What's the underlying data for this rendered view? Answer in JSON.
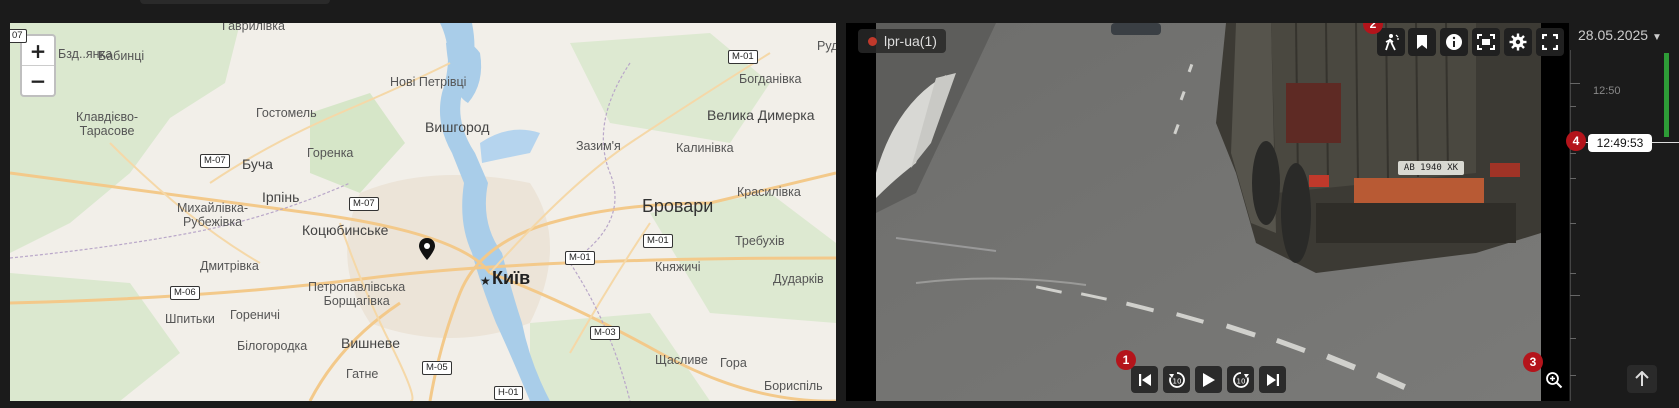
{
  "map": {
    "zoom_in": "+",
    "zoom_out": "−",
    "places": [
      {
        "name": "Бабинці"
      },
      {
        "name": "Нові Петрівці"
      },
      {
        "name": "Гостомель"
      },
      {
        "name": "Вишгород"
      },
      {
        "name": "Клавдієво-\nТарасове"
      },
      {
        "name": "Буча"
      },
      {
        "name": "Горенка"
      },
      {
        "name": "Зазим'я"
      },
      {
        "name": "Богданівка"
      },
      {
        "name": "Велика Димерка"
      },
      {
        "name": "Калинівка"
      },
      {
        "name": "Ірпінь"
      },
      {
        "name": "Михайлівка-\nРубежівка"
      },
      {
        "name": "Коцюбинське"
      },
      {
        "name": "Бровари"
      },
      {
        "name": "Красилівка"
      },
      {
        "name": "Дмитрівка"
      },
      {
        "name": "Требухів"
      },
      {
        "name": "Княжичі"
      },
      {
        "name": "Київ"
      },
      {
        "name": "Дударків"
      },
      {
        "name": "Петропавлівська\nБорщагівка"
      },
      {
        "name": "Шпитьки"
      },
      {
        "name": "Гореничі"
      },
      {
        "name": "Білогородка"
      },
      {
        "name": "Вишневе"
      },
      {
        "name": "Щасливе"
      },
      {
        "name": "Гора"
      },
      {
        "name": "Гатне"
      },
      {
        "name": "Бориспіль"
      },
      {
        "name": "Рудн"
      },
      {
        "name": "Бзд..янка"
      },
      {
        "name": "Гаврилівка"
      }
    ],
    "roads": [
      "М-01",
      "М-07",
      "М-07",
      "М-01",
      "М-01",
      "М-06",
      "М-03",
      "М-05",
      "Н-01",
      "07"
    ]
  },
  "video": {
    "camera_name": "lpr-ua(1)",
    "plate_text": "АВ 1940 ХК",
    "toolbar_icons": [
      "person-motion-icon",
      "bookmark-icon",
      "info-icon",
      "screenshot-icon",
      "settings-icon",
      "fullscreen-icon"
    ],
    "badges": {
      "playback": "1",
      "toolbar": "2",
      "zoom": "3",
      "timeline": "4"
    }
  },
  "timeline": {
    "date": "28.05.2025",
    "tick_time": "12:50",
    "cursor_time": "12:49:53"
  },
  "colors": {
    "badge": "#b4141b",
    "record_dot": "#c0392b",
    "timeline_green": "#2e9c37"
  }
}
